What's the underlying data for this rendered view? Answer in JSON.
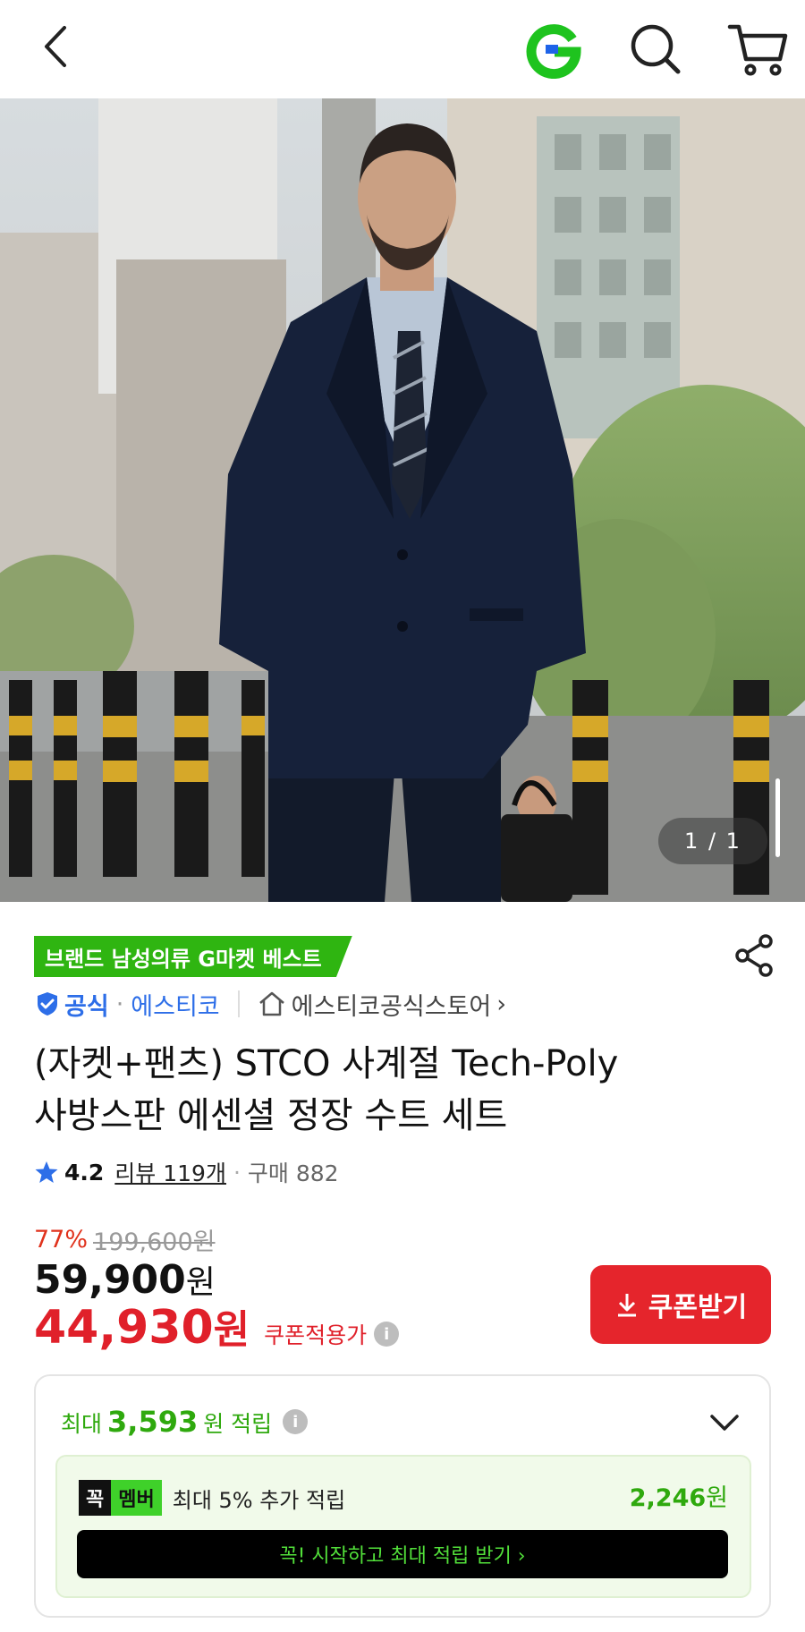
{
  "header": {
    "back_label": "back",
    "logo_letter": "G"
  },
  "hero": {
    "pager": "1 / 1"
  },
  "product": {
    "badge": "브랜드 남성의류 G마켓 베스트",
    "official_label": "공식",
    "brand": "에스티코",
    "store": "에스티코공식스토어",
    "store_chevron": "›",
    "title_line1": "(자켓+팬츠) STCO 사계절 Tech-Poly",
    "title_line2": "사방스판 에센셜 정장 수트 세트",
    "rating": "4.2",
    "review": "리뷰 119개",
    "purchase": "구매 882"
  },
  "price": {
    "discount": "77%",
    "original": "199,600원",
    "sale": "59,900",
    "sale_unit": "원",
    "coupon_price": "44,930",
    "coupon_price_unit": "원",
    "coupon_price_label": "쿠폰적용가",
    "coupon_button": "쿠폰받기"
  },
  "points": {
    "prefix": "최대",
    "amount": "3,593",
    "suffix": "원 적립",
    "member_tag_a": "꼭",
    "member_tag_b": "멤버",
    "member_text": "최대 5% 추가 적립",
    "member_amount": "2,246",
    "member_amount_unit": "원",
    "member_button": "꼭! 시작하고 최대 적립 받기  ›"
  },
  "colors": {
    "accent_green": "#2fb511",
    "price_red": "#e0202a",
    "link_blue": "#2d6ee8"
  }
}
